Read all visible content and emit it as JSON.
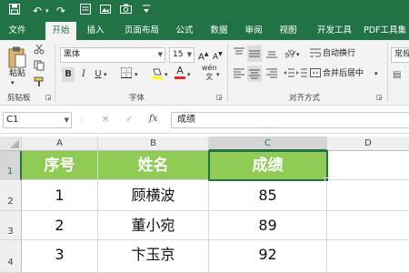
{
  "title_bar": {
    "bg": "#217346"
  },
  "tabs": [
    {
      "label": "文件",
      "active": false
    },
    {
      "label": "开始",
      "active": true
    },
    {
      "label": "插入",
      "active": false
    },
    {
      "label": "页面布局",
      "active": false
    },
    {
      "label": "公式",
      "active": false
    },
    {
      "label": "数据",
      "active": false
    },
    {
      "label": "审阅",
      "active": false
    },
    {
      "label": "视图",
      "active": false
    },
    {
      "label": "开发工具",
      "active": false
    },
    {
      "label": "PDF工具集",
      "active": false
    }
  ],
  "ribbon": {
    "paste_label": "粘贴",
    "clipboard_group": "剪贴板",
    "font_name": "黑体",
    "font_size": "15",
    "bold": "B",
    "italic": "I",
    "underline": "U",
    "font_color_glyph": "A",
    "font_group": "字体",
    "wrap_text": "自动换行",
    "merge_center": "合并后居中",
    "alignment_group": "对齐方式",
    "number_format": "常规"
  },
  "formula_bar": {
    "name_box": "C1",
    "fx": "fx",
    "content": "成绩"
  },
  "grid": {
    "columns": [
      "A",
      "B",
      "C",
      "D"
    ],
    "rows": [
      "1",
      "2",
      "3",
      "4"
    ],
    "header_row": [
      "序号",
      "姓名",
      "成绩"
    ],
    "data_rows": [
      [
        "1",
        "顾横波",
        "85"
      ],
      [
        "2",
        "董小宛",
        "89"
      ],
      [
        "3",
        "卞玉京",
        "92"
      ]
    ],
    "header_fill": "#8fcb55",
    "selected_cell": "C1"
  }
}
